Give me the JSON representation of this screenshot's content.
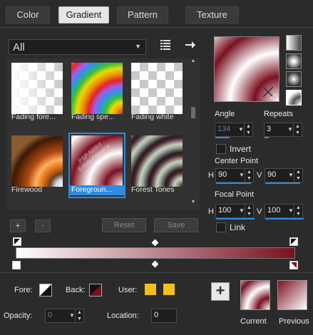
{
  "tabs": [
    {
      "label": "Color",
      "active": false
    },
    {
      "label": "Gradient",
      "active": true
    },
    {
      "label": "Pattern",
      "active": false
    },
    {
      "label": "Texture",
      "active": false
    }
  ],
  "library": {
    "filter_value": "All",
    "items": [
      {
        "label": "Fading fore...",
        "selected": false
      },
      {
        "label": "Fading spe...",
        "selected": false
      },
      {
        "label": "Fading white",
        "selected": false
      },
      {
        "label": "Firewood",
        "selected": false
      },
      {
        "label": "Foregroun...",
        "selected": true
      },
      {
        "label": "Forest Tones",
        "selected": false
      }
    ],
    "watermark_text": "PSP Addict Estela Fonseca"
  },
  "library_buttons": {
    "add": "+",
    "remove": "-",
    "reset": "Reset",
    "save": "Save"
  },
  "gradient_settings": {
    "angle_label": "Angle",
    "angle_value": "134",
    "repeats_label": "Repeats",
    "repeats_value": "3",
    "invert_label": "Invert",
    "invert_checked": false,
    "center_point_label": "Center Point",
    "center_h_label": "H",
    "center_h_value": "90",
    "center_v_label": "V",
    "center_v_value": "90",
    "focal_point_label": "Focal Point",
    "focal_h_label": "H",
    "focal_h_value": "100",
    "focal_v_label": "V",
    "focal_v_value": "100",
    "link_label": "Link",
    "link_checked": false
  },
  "editor": {
    "fore_label": "Fore:",
    "back_label": "Back:",
    "user_label": "User:",
    "opacity_label": "Opacity:",
    "opacity_value": "0",
    "location_label": "Location:",
    "location_value": "0"
  },
  "preview": {
    "add_label": "+",
    "current_label": "Current",
    "previous_label": "Previous"
  },
  "colors": {
    "foreground": "#7a1020",
    "background": "#ffffff",
    "user_swatch": "#f2c01a",
    "accent": "#2d8be0"
  }
}
